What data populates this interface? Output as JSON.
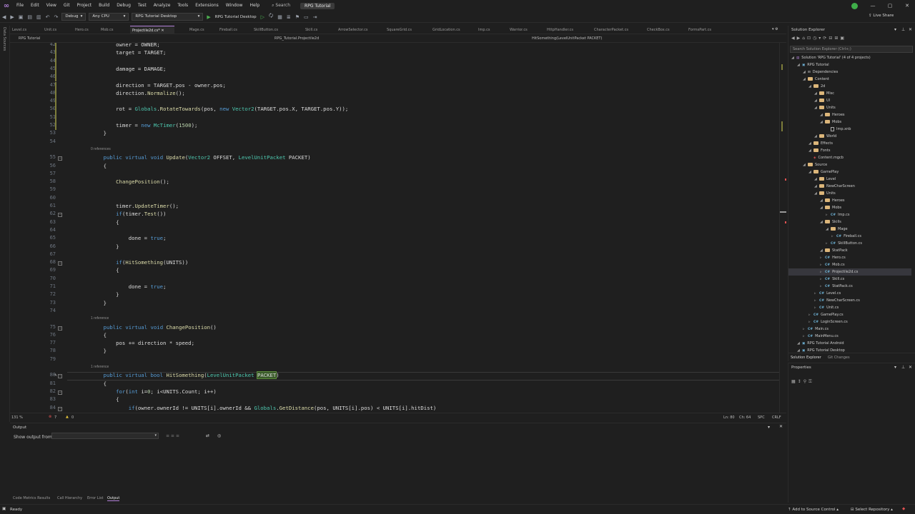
{
  "menu": [
    "File",
    "Edit",
    "View",
    "Git",
    "Project",
    "Build",
    "Debug",
    "Test",
    "Analyze",
    "Tools",
    "Extensions",
    "Window",
    "Help"
  ],
  "search_label": "Search",
  "window_title": "RPG Tutorial",
  "toolbar": {
    "config": "Debug",
    "platform": "Any CPU",
    "startup": "RPG Tutorial Desktop",
    "run_label": "RPG Tutorial Desktop",
    "live_share": "Live Share"
  },
  "left_strip_label": "Data Sources",
  "tabs": [
    "Level.cs",
    "Unit.cs",
    "Hero.cs",
    "Mob.cs",
    "Projectile2d.cs*",
    "Mage.cs",
    "Fireball.cs",
    "SkillButton.cs",
    "Skill.cs",
    "ArrowSelector.cs",
    "SquareGrid.cs",
    "GridLocation.cs",
    "Imp.cs",
    "Warrior.cs",
    "HttpHandler.cs",
    "CharacterPacket.cs",
    "CheckBox.cs",
    "FormsPart.cs"
  ],
  "nav": {
    "project": "RPG Tutorial",
    "class": "RPG_Tutorial.Projectile2d",
    "member": "HitSomething(LevelUnitPacket PACKET)"
  },
  "code": [
    {
      "ln": "42",
      "t": "        owner = OWNER;"
    },
    {
      "ln": "43",
      "t": "        target = TARGET;"
    },
    {
      "ln": "44",
      "t": ""
    },
    {
      "ln": "45",
      "t": "        damage = DAMAGE;"
    },
    {
      "ln": "46",
      "t": ""
    },
    {
      "ln": "47",
      "t": "        direction = TARGET.pos - owner.pos;"
    },
    {
      "ln": "48",
      "t": "        direction.Normalize();"
    },
    {
      "ln": "49",
      "t": ""
    },
    {
      "ln": "50",
      "t": "        rot = Globals.RotateTowards(pos, new Vector2(TARGET.pos.X, TARGET.pos.Y));"
    },
    {
      "ln": "51",
      "t": ""
    },
    {
      "ln": "52",
      "t": "        timer = new McTimer(1500);"
    },
    {
      "ln": "53",
      "t": "    }"
    },
    {
      "ln": "54",
      "t": ""
    },
    {
      "ln": "55",
      "t": "    public virtual void Update(Vector2 OFFSET, LevelUnitPacket PACKET)",
      "ref": "0 references"
    },
    {
      "ln": "56",
      "t": "    {"
    },
    {
      "ln": "57",
      "t": ""
    },
    {
      "ln": "58",
      "t": "        ChangePosition();"
    },
    {
      "ln": "59",
      "t": ""
    },
    {
      "ln": "60",
      "t": ""
    },
    {
      "ln": "61",
      "t": "        timer.UpdateTimer();"
    },
    {
      "ln": "62",
      "t": "        if(timer.Test())"
    },
    {
      "ln": "63",
      "t": "        {"
    },
    {
      "ln": "64",
      "t": ""
    },
    {
      "ln": "65",
      "t": "            done = true;"
    },
    {
      "ln": "66",
      "t": "        }"
    },
    {
      "ln": "67",
      "t": ""
    },
    {
      "ln": "68",
      "t": "        if(HitSomething(UNITS))"
    },
    {
      "ln": "69",
      "t": "        {"
    },
    {
      "ln": "70",
      "t": ""
    },
    {
      "ln": "71",
      "t": "            done = true;"
    },
    {
      "ln": "72",
      "t": "        }"
    },
    {
      "ln": "73",
      "t": "    }"
    },
    {
      "ln": "74",
      "t": ""
    },
    {
      "ln": "75",
      "t": "    public virtual void ChangePosition()",
      "ref": "1 reference"
    },
    {
      "ln": "76",
      "t": "    {"
    },
    {
      "ln": "77",
      "t": "        pos += direction * speed;"
    },
    {
      "ln": "78",
      "t": "    }"
    },
    {
      "ln": "79",
      "t": ""
    },
    {
      "ln": "80",
      "t": "    public virtual bool HitSomething(LevelUnitPacket PACKET)",
      "ref": "1 reference"
    },
    {
      "ln": "81",
      "t": "    {"
    },
    {
      "ln": "82",
      "t": "        for(int i=0; i<UNITS.Count; i++)"
    },
    {
      "ln": "83",
      "t": "        {"
    },
    {
      "ln": "84",
      "t": "            if(owner.ownerId != UNITS[i].ownerId && Globals.GetDistance(pos, UNITS[i].pos) < UNITS[i].hitDist)"
    }
  ],
  "editor_status": {
    "zoom": "131 %",
    "errors": "7",
    "warnings": "0",
    "ln": "Ln: 80",
    "ch": "Ch: 64",
    "spc": "SPC",
    "crlf": "CRLF"
  },
  "output": {
    "title": "Output",
    "show_from": "Show output from:"
  },
  "bottom_tabs": [
    "Code Metrics Results",
    "Call Hierarchy",
    "Error List",
    "Output"
  ],
  "status": {
    "ready": "Ready",
    "source_control": "Add to Source Control",
    "repo": "Select Repository"
  },
  "solution_explorer": {
    "title": "Solution Explorer",
    "search": "Search Solution Explorer (Ctrl+;)",
    "tabs": [
      "Solution Explorer",
      "Git Changes"
    ],
    "items": [
      {
        "label": "Solution 'RPG Tutorial' (4 of 4 projects)",
        "indent": 0,
        "kind": "sln"
      },
      {
        "label": "RPG Tutorial",
        "indent": 1,
        "kind": "proj"
      },
      {
        "label": "Dependencies",
        "indent": 2,
        "kind": "dep"
      },
      {
        "label": "Content",
        "indent": 2,
        "kind": "folder"
      },
      {
        "label": "2d",
        "indent": 3,
        "kind": "folder"
      },
      {
        "label": "Misc",
        "indent": 4,
        "kind": "folder"
      },
      {
        "label": "UI",
        "indent": 4,
        "kind": "folder"
      },
      {
        "label": "Units",
        "indent": 4,
        "kind": "folder"
      },
      {
        "label": "Heroes",
        "indent": 5,
        "kind": "folder"
      },
      {
        "label": "Mobs",
        "indent": 5,
        "kind": "folder"
      },
      {
        "label": "Imp.xnb",
        "indent": 6,
        "kind": "file"
      },
      {
        "label": "World",
        "indent": 4,
        "kind": "folder"
      },
      {
        "label": "Effects",
        "indent": 3,
        "kind": "folder"
      },
      {
        "label": "Fonts",
        "indent": 3,
        "kind": "folder"
      },
      {
        "label": "Content.mgcb",
        "indent": 3,
        "kind": "mgcb"
      },
      {
        "label": "Source",
        "indent": 2,
        "kind": "folder"
      },
      {
        "label": "GamePlay",
        "indent": 3,
        "kind": "folder"
      },
      {
        "label": "Level",
        "indent": 4,
        "kind": "folder"
      },
      {
        "label": "NewCharScreen",
        "indent": 4,
        "kind": "folder"
      },
      {
        "label": "Units",
        "indent": 4,
        "kind": "folder"
      },
      {
        "label": "Heroes",
        "indent": 5,
        "kind": "folder"
      },
      {
        "label": "Mobs",
        "indent": 5,
        "kind": "folder"
      },
      {
        "label": "Imp.cs",
        "indent": 6,
        "kind": "cs"
      },
      {
        "label": "Skills",
        "indent": 5,
        "kind": "folder"
      },
      {
        "label": "Mage",
        "indent": 6,
        "kind": "folder"
      },
      {
        "label": "Fireball.cs",
        "indent": 7,
        "kind": "cs"
      },
      {
        "label": "SkillButton.cs",
        "indent": 6,
        "kind": "cs"
      },
      {
        "label": "StatPack",
        "indent": 5,
        "kind": "folder"
      },
      {
        "label": "Hero.cs",
        "indent": 5,
        "kind": "cs"
      },
      {
        "label": "Mob.cs",
        "indent": 5,
        "kind": "cs"
      },
      {
        "label": "Projectile2d.cs",
        "indent": 5,
        "kind": "cs",
        "selected": true
      },
      {
        "label": "Skill.cs",
        "indent": 5,
        "kind": "cs"
      },
      {
        "label": "StatPack.cs",
        "indent": 5,
        "kind": "cs"
      },
      {
        "label": "Level.cs",
        "indent": 4,
        "kind": "cs"
      },
      {
        "label": "NewCharScreen.cs",
        "indent": 4,
        "kind": "cs"
      },
      {
        "label": "Unit.cs",
        "indent": 4,
        "kind": "cs"
      },
      {
        "label": "GamePlay.cs",
        "indent": 3,
        "kind": "cs"
      },
      {
        "label": "LoginScreen.cs",
        "indent": 3,
        "kind": "cs"
      },
      {
        "label": "Main.cs",
        "indent": 2,
        "kind": "cs"
      },
      {
        "label": "MainMenu.cs",
        "indent": 2,
        "kind": "cs"
      },
      {
        "label": "RPG Tutorial Android",
        "indent": 1,
        "kind": "proj"
      },
      {
        "label": "RPG Tutorial Desktop",
        "indent": 1,
        "kind": "proj"
      }
    ]
  },
  "properties": {
    "title": "Properties"
  },
  "colors": {
    "accent": "#b180d7",
    "highlight": "#3a5a2a",
    "selected_row": "#37373d"
  }
}
